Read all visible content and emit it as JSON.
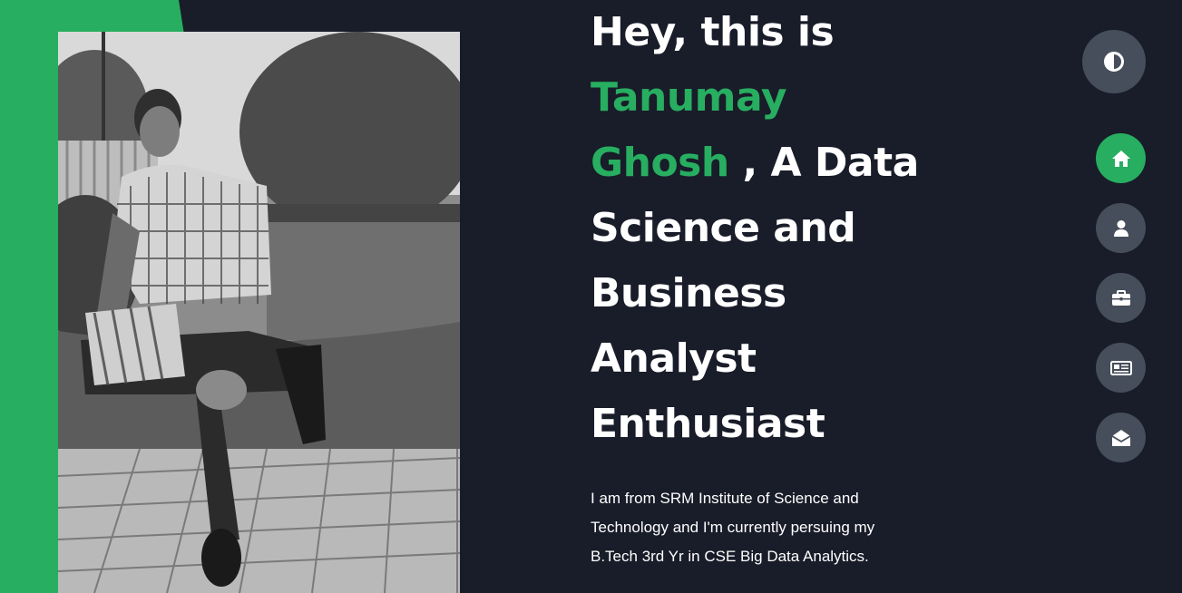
{
  "hero": {
    "line1": "Hey, this is",
    "name_first": "Tanumay",
    "name_last": "Ghosh",
    "after_name": " , A Data",
    "line4": "Science and",
    "line5": "Business",
    "line6": "Analyst",
    "line7": "Enthusiast",
    "intro": "I am from SRM Institute of Science and Technology and I'm currently persuing my B.Tech 3rd Yr in CSE Big Data Analytics."
  },
  "theme": {
    "icon": "half-circle-contrast-icon"
  },
  "nav": {
    "items": [
      {
        "name": "home",
        "icon": "home-icon",
        "active": true
      },
      {
        "name": "about",
        "icon": "user-icon",
        "active": false
      },
      {
        "name": "portfolio",
        "icon": "briefcase-icon",
        "active": false
      },
      {
        "name": "blog",
        "icon": "newspaper-icon",
        "active": false
      },
      {
        "name": "contact",
        "icon": "envelope-open-icon",
        "active": false
      }
    ]
  },
  "colors": {
    "background": "#191c29",
    "accent": "#27ae60",
    "button": "#454e5a",
    "text": "#ffffff"
  }
}
